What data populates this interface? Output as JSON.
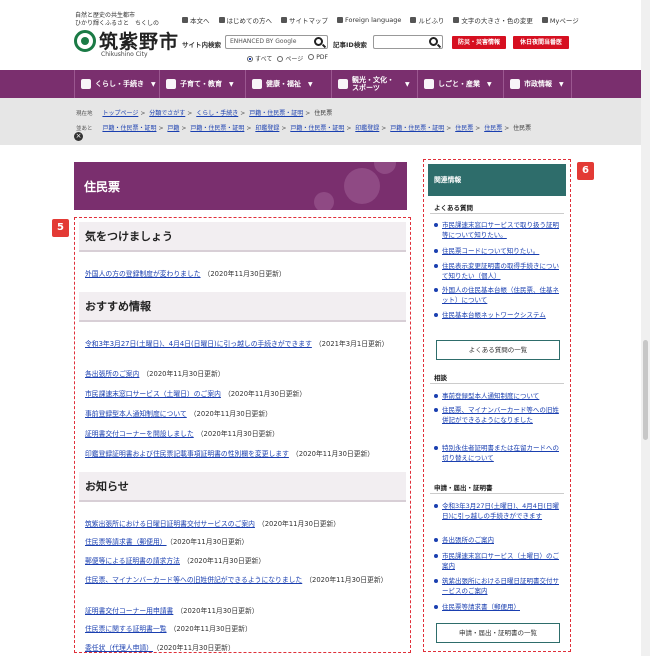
{
  "header": {
    "tagline_1": "自然と歴史の共生都市",
    "tagline_2": "ひかり輝くふるさと　ちくしの",
    "city_name": "筑紫野市",
    "city_name_en": "Chikushino City",
    "util_nav": [
      "本文へ",
      "はじめての方へ",
      "サイトマップ",
      "Foreign language",
      "ルビふり",
      "文字の大きさ・色の変更",
      "Myページ"
    ],
    "search_label": "サイト内検索",
    "search_placeholder": "ENHANCED BY Google",
    "search_scope": [
      "すべて",
      "ページ",
      "PDF"
    ],
    "id_search_label": "記事ID検索",
    "disaster_button": "防災・災害情報",
    "holiday_button": "休日夜間当番医"
  },
  "main_nav": [
    "くらし・手続き",
    "子育て・教育",
    "健康・福祉",
    "観光・文化・スポーツ",
    "しごと・産業",
    "市政情報"
  ],
  "breadcrumb": {
    "current_tag": "現在地",
    "current_path": [
      "トップページ",
      "分類でさがす",
      "くらし・手続き",
      "戸籍・住民票・証明",
      "住民票"
    ],
    "also_tag": "並あと",
    "also_path": [
      "戸籍・住民票・証明",
      "戸籍",
      "戸籍・住民票・証明",
      "印鑑登録",
      "戸籍・住民票・証明",
      "印鑑登録",
      "戸籍・住民票・証明",
      "住民票",
      "住民票",
      "住民票"
    ]
  },
  "page_title": "住民票",
  "main": {
    "badge": "5",
    "sections": [
      {
        "heading": "気をつけましょう",
        "entries": [
          {
            "title": "外国人の方の登録制度が変わりました",
            "date": "（2020年11月30日更新）"
          }
        ]
      },
      {
        "heading": "おすすめ情報",
        "entries": [
          {
            "title": "令和3年3月27日(土曜日)、4月4日(日曜日)に引っ越しの手続きができます",
            "date": "（2021年3月1日更新）"
          },
          {
            "title": "各出張所のご案内",
            "date": "（2020年11月30日更新）"
          },
          {
            "title": "市民課速末窓口サービス（土曜日）のご案内",
            "date": "（2020年11月30日更新）"
          },
          {
            "title": "事前登録型本人通知制度について",
            "date": "（2020年11月30日更新）"
          },
          {
            "title": "証明書交付コーナーを開設しました",
            "date": "（2020年11月30日更新）"
          },
          {
            "title": "印鑑登録証明書および住民票記載事項証明書の性別欄を変更します",
            "date": "（2020年11月30日更新）"
          }
        ]
      },
      {
        "heading": "お知らせ",
        "entries": [
          {
            "title": "筑紫出張所における日曜日証明書交付サービスのご案内",
            "date": "（2020年11月30日更新）"
          },
          {
            "title": "住民票等請求書（郵便用）",
            "date": "（2020年11月30日更新）"
          },
          {
            "title": "郵便等による証明書の請求方法",
            "date": "（2020年11月30日更新）"
          },
          {
            "title": "住民票、マイナンバーカード等への旧姓併記ができるようになりました",
            "date": "（2020年11月30日更新）"
          },
          {
            "title": "証明書交付コーナー用申請書",
            "date": "（2020年11月30日更新）"
          },
          {
            "title": "住民票に関する証明書一覧",
            "date": "（2020年11月30日更新）"
          },
          {
            "title": "委任状（代理人申請）",
            "date": "（2020年11月30日更新）"
          }
        ]
      }
    ]
  },
  "sidebar": {
    "badge": "6",
    "heading": "関連情報",
    "faq_title": "よくある質問",
    "faq_items": [
      "市民課速末窓口サービスで取り扱う証明等について知りたい。",
      "住民票コードについて知りたい。",
      "住民表示変更証明書の取得手続きについて知りたい（個人）",
      "外国人の住民基本台帳（住民票、住基ネット）について",
      "住民基本台帳ネットワークシステム"
    ],
    "faq_button": "よくある質問の一覧",
    "consult_title": "相談",
    "consult_items": [
      "事前登録型本人通知制度について",
      "住民票、マイナンバーカード等への旧姓併記ができるようになりました",
      "特別永住者証明書または在留カードへの切り替えについて"
    ],
    "apply_title": "申請・届出・証明書",
    "apply_items": [
      "令和3年3月27日(土曜日)、4月4日(日曜日)に引っ越しの手続きができます",
      "各出張所のご案内",
      "市民課速末窓口サービス（土曜日）のご案内",
      "筑紫出張所における日曜日証明書交付サービスのご案内",
      "住民票等請求書（郵便用）"
    ],
    "apply_button": "申請・届出・証明書の一覧"
  }
}
